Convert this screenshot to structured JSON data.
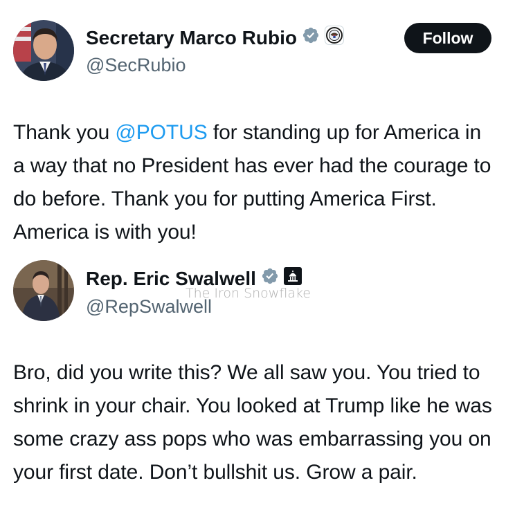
{
  "main_post": {
    "author_name": "Secretary Marco Rubio",
    "handle": "@SecRubio",
    "follow_label": "Follow",
    "text_before_mention": "Thank you ",
    "mention": "@POTUS",
    "text_after_mention": " for standing up for America in a way that no President has ever had the courage to do before. Thank you for putting America First. America is with you!"
  },
  "quoted_post": {
    "author_name": "Rep. Eric Swalwell",
    "handle": "@RepSwalwell",
    "text": "Bro, did you write this? We all saw you. You tried to shrink in your chair. You looked at Trump like he was some crazy ass pops who was embarrassing you on your first date. Don’t bullshit us. Grow a pair."
  },
  "watermark": "The Iron Snowflake",
  "icons": {
    "verified": "verified-badge-icon",
    "state_department_seal": "state-department-seal-icon",
    "capitol": "capitol-building-icon"
  },
  "colors": {
    "text": "#0f1419",
    "secondary_text": "#536471",
    "mention": "#1d9bf0",
    "follow_button": "#0f1419",
    "verified_badge": "#829aab"
  }
}
